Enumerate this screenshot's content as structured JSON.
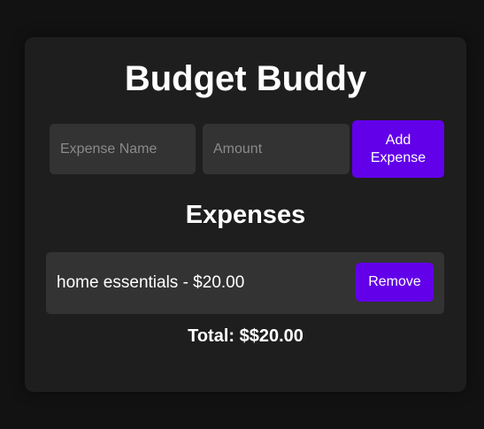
{
  "app": {
    "title": "Budget Buddy"
  },
  "form": {
    "name_placeholder": "Expense Name",
    "name_value": "",
    "amount_placeholder": "Amount",
    "amount_value": "",
    "add_label_line1": "Add",
    "add_label_line2": "Expense"
  },
  "expenses": {
    "heading": "Expenses",
    "items": [
      {
        "text": "home essentials - $20.00",
        "remove_label": "Remove"
      }
    ]
  },
  "total": {
    "text": "Total: $$20.00"
  },
  "colors": {
    "background": "#121212",
    "card": "#1e1e1e",
    "field": "#333333",
    "accent": "#6200ea",
    "text": "#ffffff",
    "placeholder": "#8a8a8a"
  }
}
